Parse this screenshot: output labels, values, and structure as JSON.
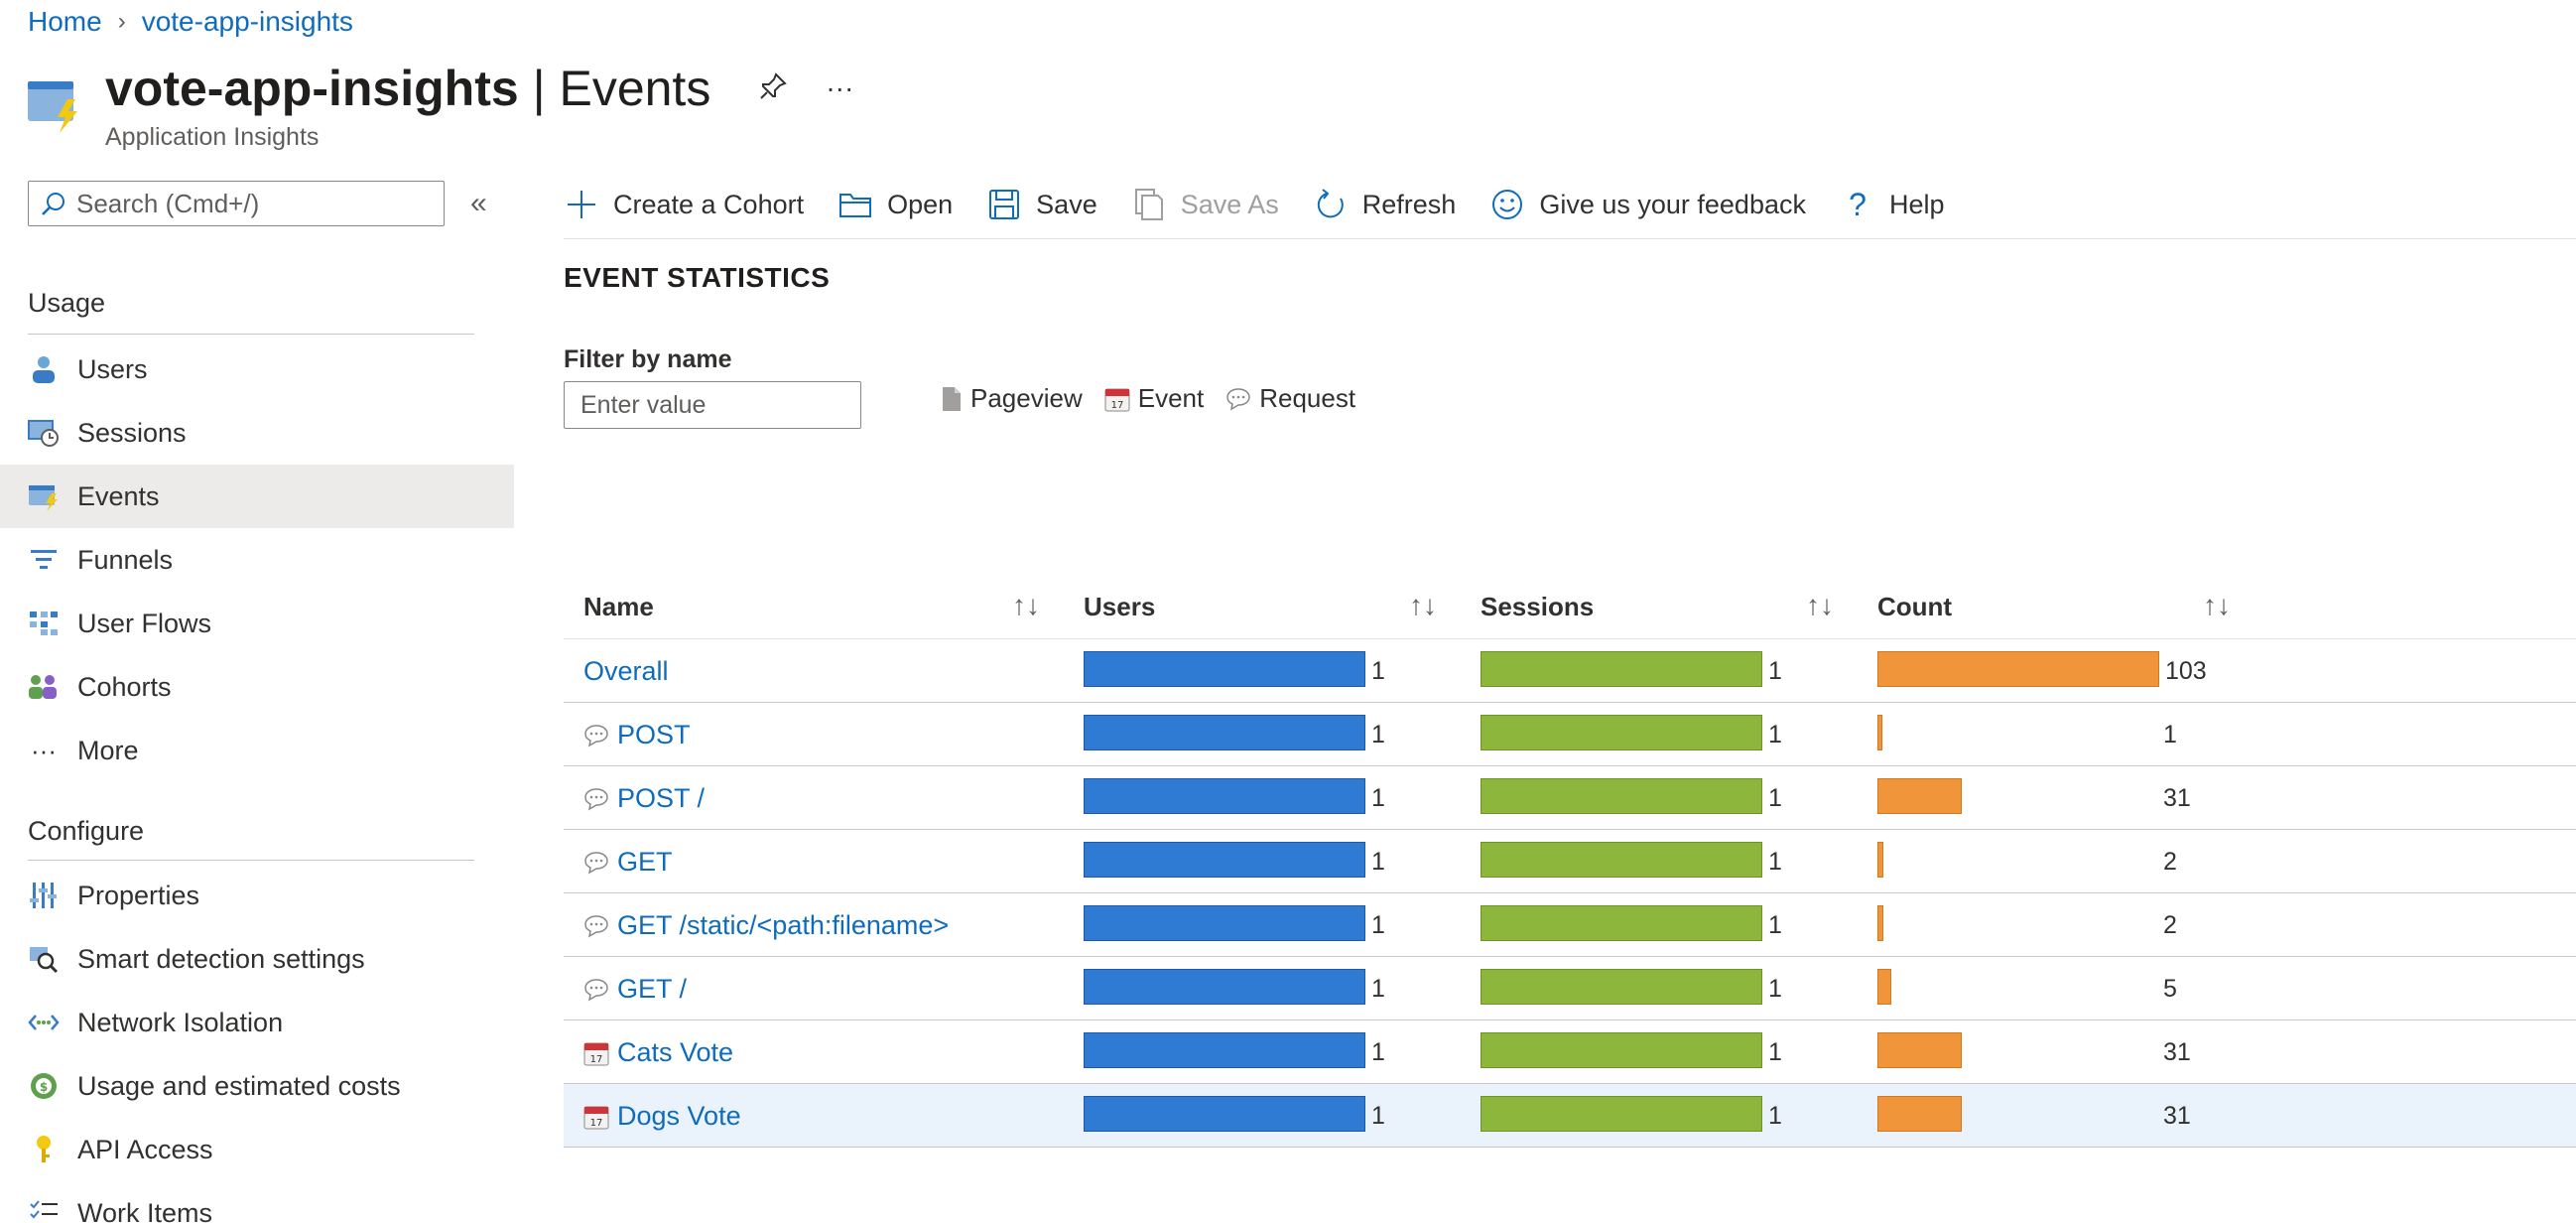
{
  "breadcrumb": {
    "home": "Home",
    "resource": "vote-app-insights"
  },
  "header": {
    "title_bold": "vote-app-insights",
    "title_sep": " | ",
    "title_light": "Events",
    "subtitle": "Application Insights",
    "more": "···"
  },
  "sidebar": {
    "search_placeholder": "Search (Cmd+/)",
    "collapse": "«",
    "sections": {
      "usage": "Usage",
      "configure": "Configure"
    },
    "usage_items": [
      "Users",
      "Sessions",
      "Events",
      "Funnels",
      "User Flows",
      "Cohorts",
      "More"
    ],
    "configure_items": [
      "Properties",
      "Smart detection settings",
      "Network Isolation",
      "Usage and estimated costs",
      "API Access",
      "Work Items"
    ],
    "active_item": "Events"
  },
  "toolbar": {
    "create_cohort": "Create a Cohort",
    "open": "Open",
    "save": "Save",
    "save_as": "Save As",
    "refresh": "Refresh",
    "feedback": "Give us your feedback",
    "help": "Help"
  },
  "main": {
    "stats_title": "EVENT STATISTICS",
    "filter_label": "Filter by name",
    "filter_placeholder": "Enter value",
    "legend": {
      "pageview": "Pageview",
      "event": "Event",
      "request": "Request"
    }
  },
  "table": {
    "columns": [
      "Name",
      "Users",
      "Sessions",
      "Count"
    ],
    "max_count": 103,
    "rows": [
      {
        "name": "Overall",
        "type": "none",
        "users": 1,
        "sessions": 1,
        "count": 103
      },
      {
        "name": "POST",
        "type": "request",
        "users": 1,
        "sessions": 1,
        "count": 1
      },
      {
        "name": "POST /",
        "type": "request",
        "users": 1,
        "sessions": 1,
        "count": 31
      },
      {
        "name": "GET",
        "type": "request",
        "users": 1,
        "sessions": 1,
        "count": 2
      },
      {
        "name": "GET /static/<path:filename>",
        "type": "request",
        "users": 1,
        "sessions": 1,
        "count": 2
      },
      {
        "name": "GET /",
        "type": "request",
        "users": 1,
        "sessions": 1,
        "count": 5
      },
      {
        "name": "Cats Vote",
        "type": "event",
        "users": 1,
        "sessions": 1,
        "count": 31
      },
      {
        "name": "Dogs Vote",
        "type": "event",
        "users": 1,
        "sessions": 1,
        "count": 31
      }
    ]
  },
  "colors": {
    "link": "#0f6cbd",
    "users_bar": "#2f7ad3",
    "sessions_bar": "#8cb63c",
    "count_bar": "#f0953a",
    "selected_row": "#eaf3fb",
    "active_nav": "#edebe9"
  }
}
